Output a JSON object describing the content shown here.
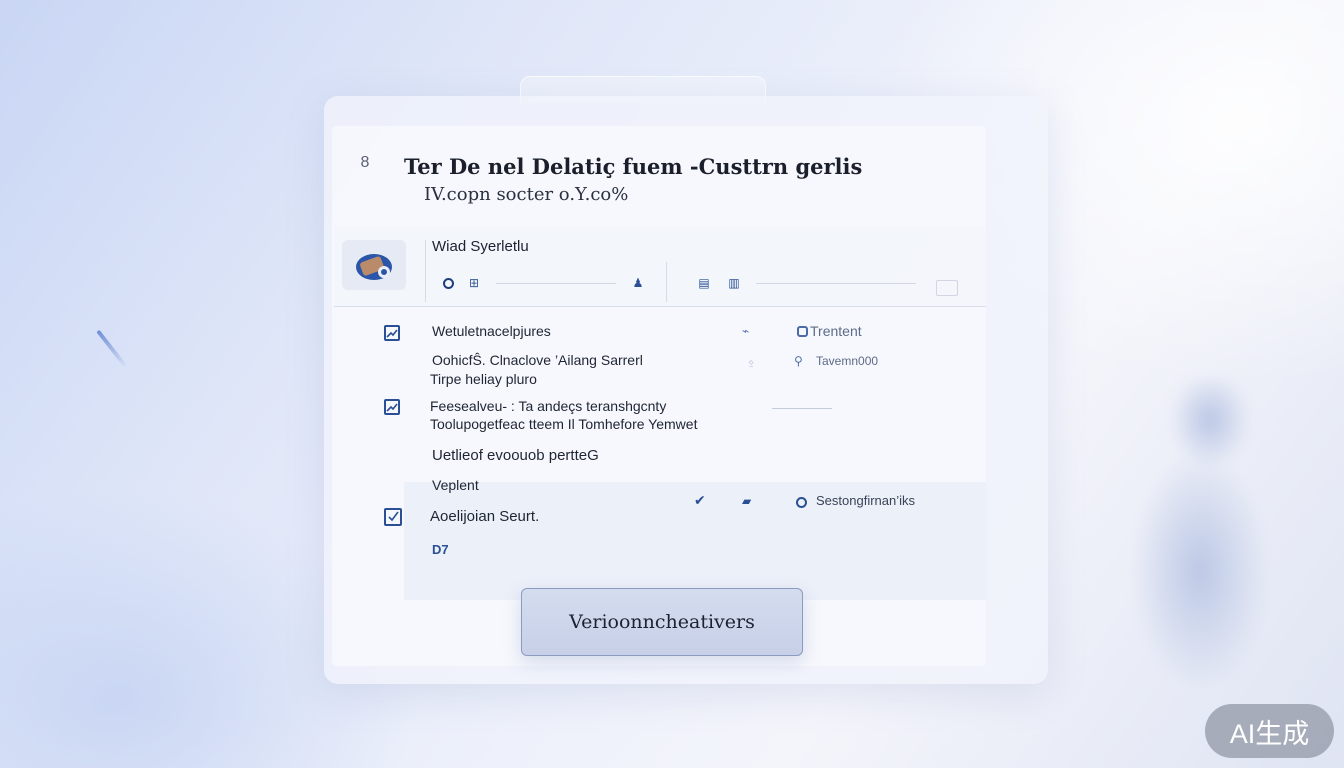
{
  "window": {
    "app_icon": "8",
    "title": "Ter De nel Delatiç fuem -Custtrn gerlis",
    "subtitle": "IV.copn socter o.Y.co%"
  },
  "header": {
    "section_title": "Wiad Syerletlu"
  },
  "rows": {
    "row1": {
      "label": "Wetuletnacelpjures",
      "status": "Trentent",
      "sub_status": "Tavemn000"
    },
    "row2": {
      "line1": "OohicfŜ.  Clnaclove ’Ailang Sarrerl",
      "line2": "Tirpe heliay pluro"
    },
    "row3": {
      "line1": "Feesealveu- : Ta andeçs teranshgcnty",
      "line2": "Toolupogetfeac tteem Il Tomhefore Yemwet"
    },
    "group": {
      "heading": "Uetlieof evoouob pertteG",
      "label": "Veplent"
    },
    "row4": {
      "label": "Aoelijoian Seurt.",
      "status": "Sestongfirnan’iks",
      "tag": "D7"
    }
  },
  "cta": {
    "label": "Verioonncheativers"
  },
  "badge": {
    "label": "AI生成"
  },
  "icons": {
    "app": "app-badge-icon",
    "avatar": "tools-illustration-icon",
    "check": "checkbox-icon",
    "status": "radio-icon"
  },
  "colors": {
    "accent": "#2a4f95",
    "background": "#dfe6f8",
    "cta": "#c7d0e8"
  }
}
